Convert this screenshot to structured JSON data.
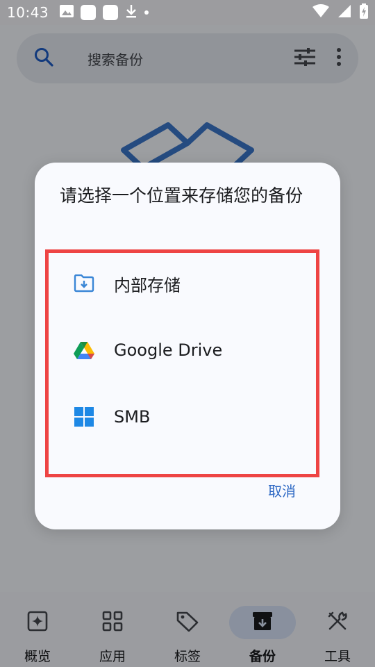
{
  "status_bar": {
    "time": "10:43"
  },
  "search": {
    "placeholder": "搜索备份",
    "icons": [
      "search-icon",
      "filter-icon",
      "more-vert-icon"
    ]
  },
  "dialog": {
    "title": "请选择一个位置来存储您的备份",
    "options": [
      {
        "label": "内部存储",
        "icon": "folder-download-icon"
      },
      {
        "label": "Google Drive",
        "icon": "google-drive-icon"
      },
      {
        "label": "SMB",
        "icon": "windows-icon"
      }
    ],
    "cancel_label": "取消"
  },
  "bottom_nav": {
    "items": [
      {
        "label": "概览",
        "icon": "overview-icon",
        "active": false
      },
      {
        "label": "应用",
        "icon": "apps-grid-icon",
        "active": false
      },
      {
        "label": "标签",
        "icon": "tag-icon",
        "active": false
      },
      {
        "label": "备份",
        "icon": "archive-icon",
        "active": true
      },
      {
        "label": "工具",
        "icon": "tools-icon",
        "active": false
      }
    ]
  },
  "colors": {
    "accent": "#2d68c4",
    "highlight": "#ee4444",
    "dialog_bg": "#f9fafe"
  }
}
